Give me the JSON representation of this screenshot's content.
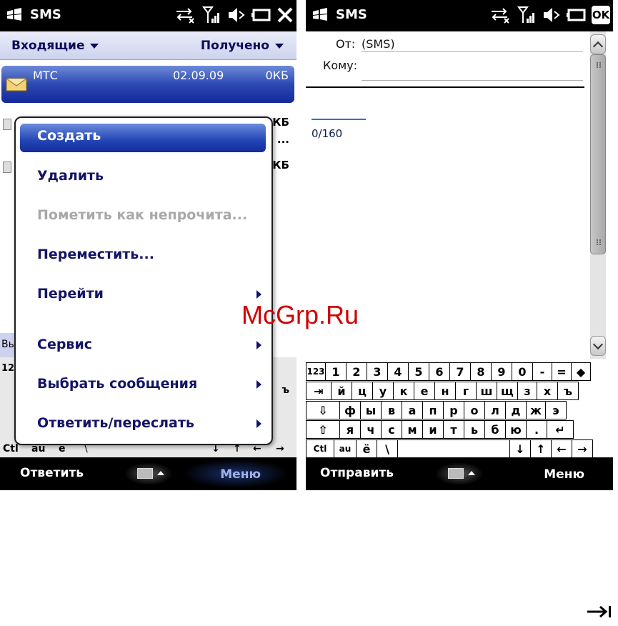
{
  "left_screen": {
    "status": {
      "app_title": "SMS"
    },
    "header": {
      "folder": "Входящие",
      "sort": "Получено"
    },
    "selected_message": {
      "sender": "МТС",
      "date": "02.09.09",
      "size": "0КБ"
    },
    "bg_rows": [
      {
        "text": "КБ"
      },
      {
        "text": "..."
      },
      {
        "text": "КБ"
      }
    ],
    "under_bar_text": "Вь",
    "mini_kb": {
      "r1_label": "12",
      "r4": [
        "Ctl",
        "au",
        "ё",
        "\\"
      ],
      "r4_right": [
        "↓",
        "↑",
        "←",
        "→"
      ],
      "r2_right": "ъ"
    },
    "menu": {
      "items": [
        {
          "label": "Создать",
          "selected": true,
          "submenu": false,
          "enabled": true
        },
        {
          "label": "Удалить",
          "selected": false,
          "submenu": false,
          "enabled": true
        },
        {
          "label": "Пометить как непрочита...",
          "selected": false,
          "submenu": false,
          "enabled": false
        },
        {
          "label": "Переместить...",
          "selected": false,
          "submenu": false,
          "enabled": true
        },
        {
          "label": "Перейти",
          "selected": false,
          "submenu": true,
          "enabled": true
        },
        {
          "label": "Сервис",
          "selected": false,
          "submenu": true,
          "enabled": true
        },
        {
          "label": "Выбрать сообщения",
          "selected": false,
          "submenu": true,
          "enabled": true
        },
        {
          "label": "Ответить/переслать",
          "selected": false,
          "submenu": true,
          "enabled": true
        }
      ]
    },
    "softkeys": {
      "left": "Ответить",
      "right": "Меню"
    }
  },
  "right_screen": {
    "status": {
      "app_title": "SMS",
      "ok": "OK"
    },
    "from_label": "От:",
    "from_value": "(SMS)",
    "to_label": "Кому:",
    "counter": "0/160",
    "keyboard": {
      "row1": [
        "123",
        "1",
        "2",
        "3",
        "4",
        "5",
        "6",
        "7",
        "8",
        "9",
        "0",
        "-",
        "=",
        "◆"
      ],
      "row2": [
        "⇥",
        "й",
        "ц",
        "у",
        "к",
        "е",
        "н",
        "г",
        "ш",
        "щ",
        "з",
        "х",
        "ъ"
      ],
      "row3": [
        "⇩",
        "ф",
        "ы",
        "в",
        "а",
        "п",
        "р",
        "о",
        "л",
        "д",
        "ж",
        "э"
      ],
      "row4": [
        "⇧",
        "я",
        "ч",
        "с",
        "м",
        "и",
        "т",
        "ь",
        "б",
        "ю",
        ".",
        "↵"
      ],
      "row5": [
        "Ctl",
        "au",
        "ё",
        "\\",
        "",
        "↓",
        "↑",
        "←",
        "→"
      ]
    },
    "softkeys": {
      "left": "Отправить",
      "right": "Меню"
    }
  },
  "watermark": "McGrp.Ru",
  "colors": {
    "menu_text": "#141466",
    "selection": "#2345b5",
    "watermark": "#d00000"
  }
}
